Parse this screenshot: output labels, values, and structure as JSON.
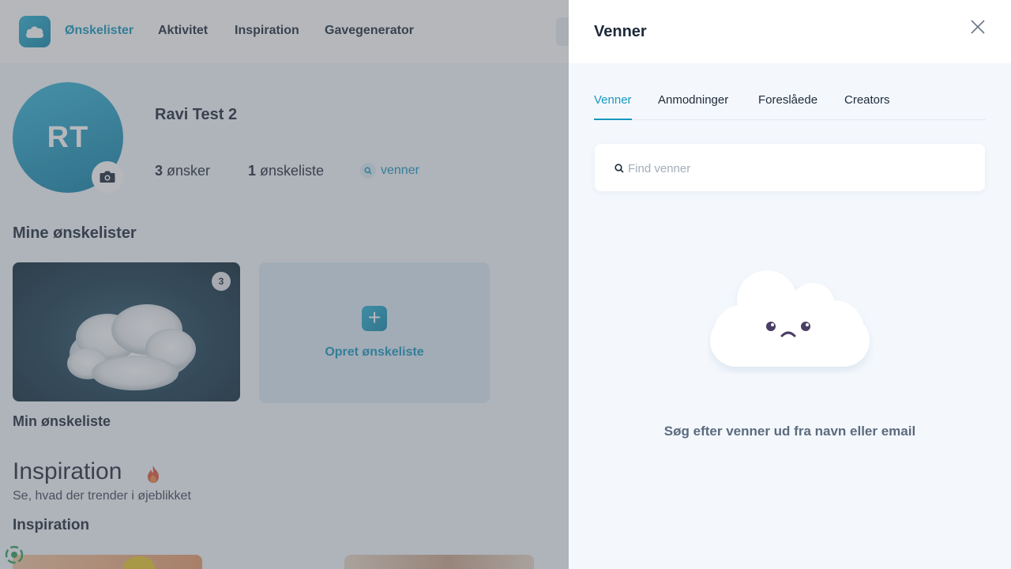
{
  "nav": {
    "items": [
      "Ønskelister",
      "Aktivitet",
      "Inspiration",
      "Gavegenerator"
    ],
    "active": "Ønskelister"
  },
  "profile": {
    "initials": "RT",
    "name": "Ravi Test 2",
    "wishes_count": "3",
    "wishes_label": "ønsker",
    "lists_count": "1",
    "lists_label": "ønskeliste",
    "friends_label": "venner"
  },
  "wishlists": {
    "title": "Mine ønskelister",
    "cards": [
      {
        "name": "Min ønskeliste",
        "count": "3"
      }
    ],
    "create_label": "Opret ønskeliste"
  },
  "inspiration": {
    "heading": "Inspiration",
    "subtitle": "Se, hvad der trender i øjeblikket",
    "section_title": "Inspiration"
  },
  "panel": {
    "title": "Venner",
    "tabs": [
      "Venner",
      "Anmodninger",
      "Foreslåede",
      "Creators"
    ],
    "active_tab": "Venner",
    "search_placeholder": "Find venner",
    "search_value": "",
    "empty_message": "Søg efter venner ud fra navn eller email"
  },
  "colors": {
    "accent": "#1597bd",
    "panel_bg": "#f4f8fd",
    "overlay": "#5a5f69"
  }
}
